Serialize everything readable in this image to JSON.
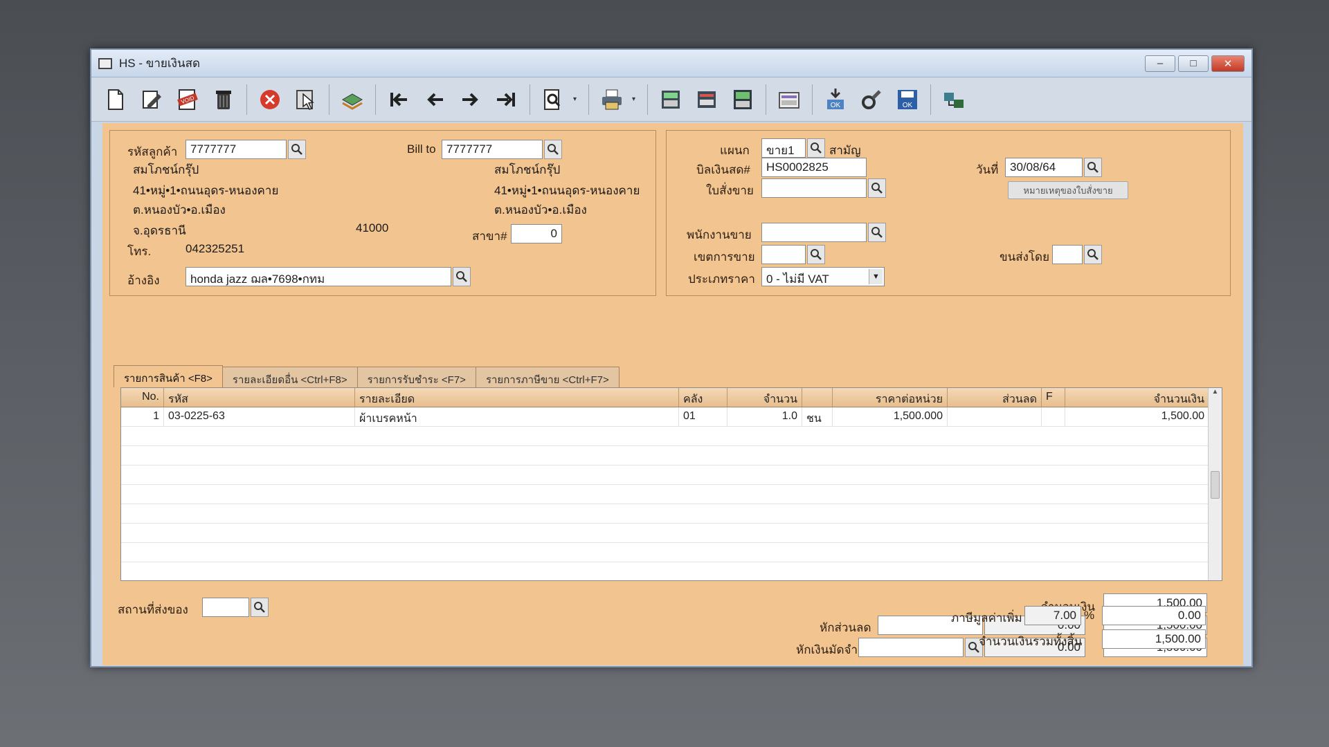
{
  "window": {
    "title": "HS - ขายเงินสด",
    "controls": {
      "minimize": "–",
      "maximize": "□",
      "close": "✕"
    }
  },
  "toolbar": {
    "items": [
      "new-doc-icon",
      "edit-icon",
      "void-icon",
      "trash-icon",
      "cancel-icon",
      "pointer-icon",
      "stack-icon",
      "first-icon",
      "prev-icon",
      "next-icon",
      "last-icon",
      "search-doc-icon",
      "printer-icon",
      "calc1-icon",
      "printer2-icon",
      "calc2-icon",
      "keyboard-icon",
      "ok-pin-icon",
      "tools-icon",
      "ok-save-icon",
      "network-icon"
    ],
    "void_text": "VOID",
    "ok_text": "OK"
  },
  "customer": {
    "code_label": "รหัสลูกค้า",
    "code": "7777777",
    "name": "สมโภชน์กรุ๊ป",
    "addr1": "41•หมู่•1•ถนนอุดร-หนองคาย",
    "addr2": "ต.หนองบัว•อ.เมือง",
    "addr3": "จ.อุดรธานี",
    "zip": "41000",
    "tel_label": "โทร.",
    "tel": "042325251",
    "ref_label": "อ้างอิง",
    "ref": "honda jazz ฌล•7698•กทม",
    "branch_label": "สาขา#",
    "branch": "0"
  },
  "bill_to": {
    "label": "Bill to",
    "code": "7777777",
    "name": "สมโภชน์กรุ๊ป",
    "addr1": "41•หมู่•1•ถนนอุดร-หนองคาย",
    "addr2": "ต.หนองบัว•อ.เมือง"
  },
  "doc": {
    "dept_label": "แผนก",
    "dept": "ขาย1",
    "dept_name": "สามัญ",
    "bill_label": "บิลเงินสด#",
    "bill_no": "HS0002825",
    "order_label": "ใบสั่งขาย",
    "order": "",
    "date_label": "วันที่",
    "date": "30/08/64",
    "note_button": "หมายเหตุของใบสั่งขาย",
    "salesman_label": "พนักงานขาย",
    "salesman": "",
    "area_label": "เขตการขาย",
    "area": "",
    "ship_label": "ขนส่งโดย",
    "ship": "",
    "price_type_label": "ประเภทราคา",
    "price_type": "0 - ไม่มี VAT"
  },
  "tabs": [
    {
      "label": "รายการสินค้า <F8>"
    },
    {
      "label": "รายละเอียดอื่น <Ctrl+F8>"
    },
    {
      "label": "รายการรับชำระ <F7>"
    },
    {
      "label": "รายการภาษีขาย <Ctrl+F7>"
    }
  ],
  "grid": {
    "headers": [
      "No.",
      "รหัส",
      "รายละเอียด",
      "คลัง",
      "จำนวน",
      "",
      "ราคาต่อหน่วย",
      "ส่วนลด",
      "F",
      "จำนวนเงิน"
    ],
    "rows": [
      {
        "no": "1",
        "code": "03-0225-63",
        "desc": "ผ้าเบรคหน้า",
        "wh": "01",
        "qty": "1.0",
        "unit": "ชน",
        "price": "1,500.000",
        "disc": "",
        "f": "",
        "amount": "1,500.00"
      }
    ]
  },
  "footer": {
    "ship_place_label": "สถานที่ส่งของ",
    "ship_place": "",
    "amount_label": "จำนวนเงิน",
    "amount": "1,500.00",
    "discount_label": "หักส่วนลด",
    "discount_input": "",
    "discount_value": "0.00",
    "discount_total": "1,500.00",
    "deposit_label": "หักเงินมัดจำ",
    "deposit_input": "",
    "deposit_value": "0.00",
    "deposit_total": "1,500.00",
    "vat_label": "ภาษีมูลค่าเพิ่ม",
    "vat_rate": "7.00",
    "vat_pct": "%",
    "vat_amount": "0.00",
    "grand_label": "จำนวนเงินรวมทั้งสิ้น",
    "grand_total": "1,500.00"
  }
}
